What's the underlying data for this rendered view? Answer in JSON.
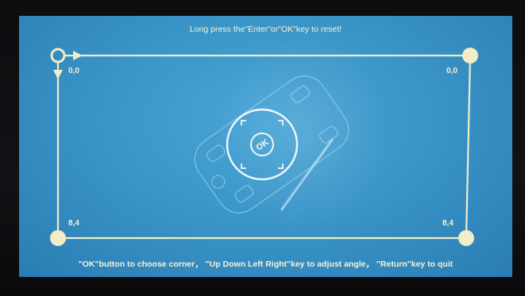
{
  "messages": {
    "top": "Long press the\"Enter\"or\"OK\"key to reset!",
    "bottom": "\"OK\"button to choose corner， \"Up Down Left Right\"key to adjust angle， \"Return\"key to quit"
  },
  "corners": {
    "top_left": "0,0",
    "top_right": "0,0",
    "bottom_left": "8,4",
    "bottom_right": "8,4"
  },
  "remote": {
    "ok_label": "OK"
  },
  "colors": {
    "screen_background": "#3a95c8",
    "frame_line": "#f2ecc8",
    "text": "#f6f1d8"
  },
  "icons": {
    "selected_corner": "hollow-circle-icon",
    "direction_arrows": "arrow-right-icon, arrow-down-icon",
    "illustration": "remote-control-icon"
  }
}
